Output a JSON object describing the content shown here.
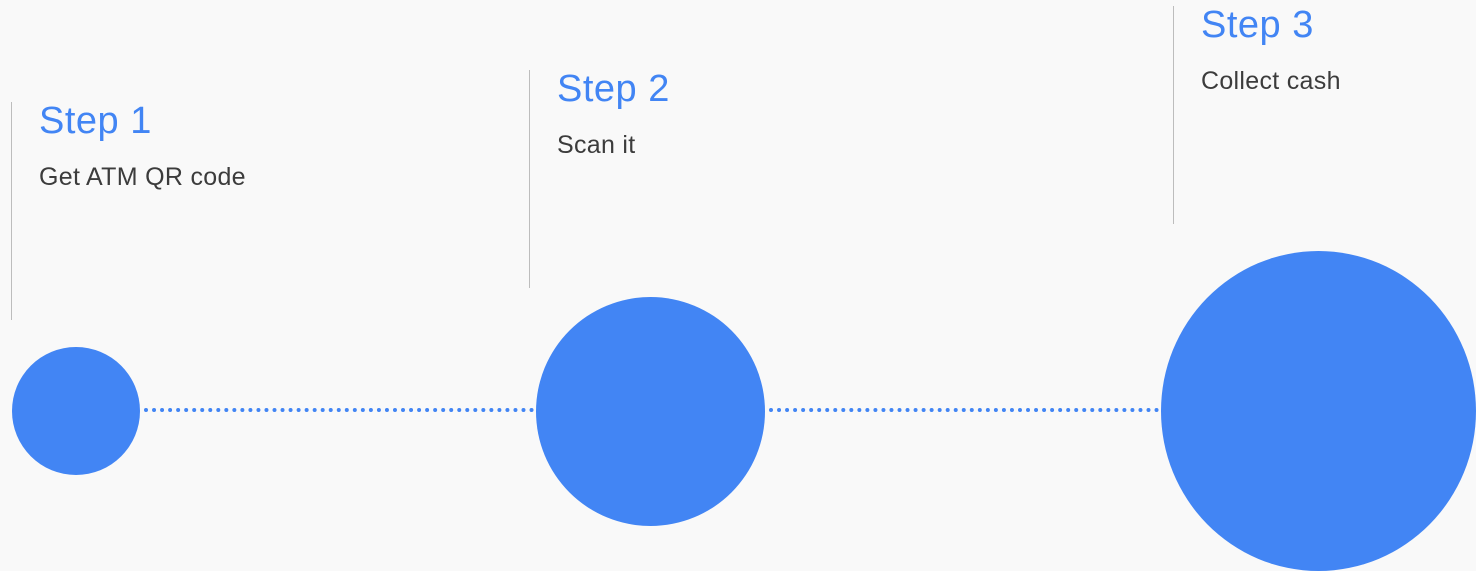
{
  "colors": {
    "accent": "#4285f4",
    "circle": "#4285f4",
    "dots": "#4285f4",
    "divider": "#bdbdbd",
    "text": "#3c3c3c"
  },
  "steps": [
    {
      "title": "Step 1",
      "description": "Get ATM QR code"
    },
    {
      "title": "Step 2",
      "description": "Scan it"
    },
    {
      "title": "Step 3",
      "description": "Collect cash"
    }
  ]
}
